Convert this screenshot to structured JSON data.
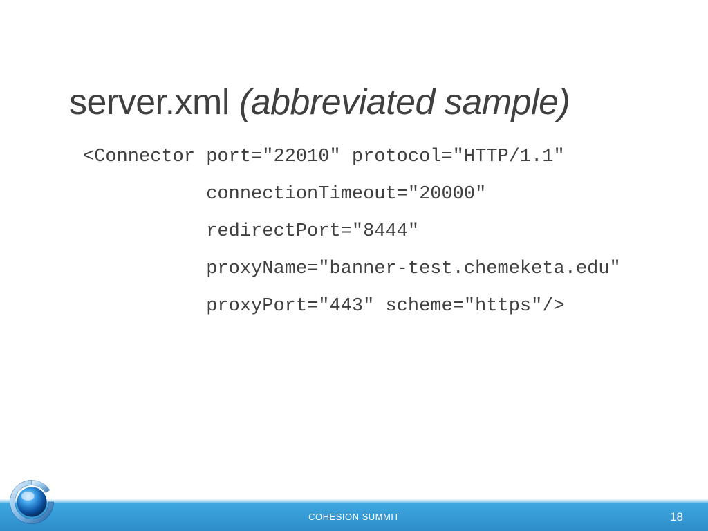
{
  "title": {
    "main": "server.xml ",
    "italic": "(abbreviated sample)"
  },
  "code": {
    "line1": "<Connector port=\"22010\" protocol=\"HTTP/1.1\"",
    "line2": "           connectionTimeout=\"20000\"",
    "line3": "           redirectPort=\"8444\"",
    "line4": "           proxyName=\"banner-test.chemeketa.edu\"",
    "line5": "           proxyPort=\"443\" scheme=\"https\"/>"
  },
  "footer": {
    "label": "COHESION SUMMIT",
    "page": "18"
  }
}
